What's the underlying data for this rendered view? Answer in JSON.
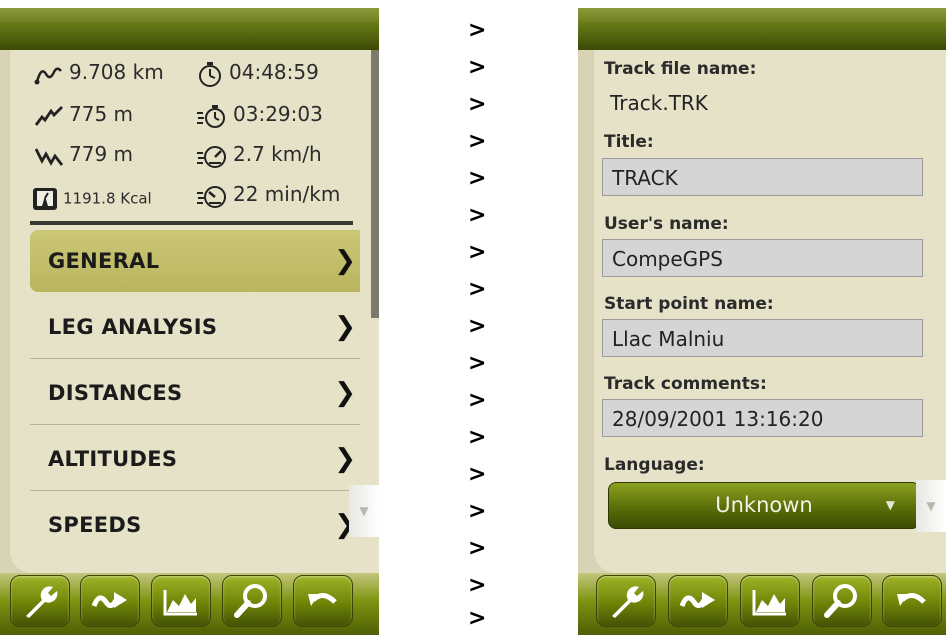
{
  "arrows": [
    ">",
    ">",
    ">",
    ">",
    ">",
    ">",
    ">",
    ">",
    ">",
    ">",
    ">",
    ">",
    ">",
    ">",
    ">",
    ">",
    ">"
  ],
  "left_screen": {
    "stats": [
      {
        "icon": "distance-icon",
        "value": "9.708 km"
      },
      {
        "icon": "stopwatch-icon",
        "value": "04:48:59"
      },
      {
        "icon": "ascent-icon",
        "value": "775 m"
      },
      {
        "icon": "moving-time-icon",
        "value": "03:29:03"
      },
      {
        "icon": "descent-icon",
        "value": "779 m"
      },
      {
        "icon": "speed-gauge-icon",
        "value": "2.7 km/h"
      },
      {
        "icon": "scale-icon",
        "value": "1191.8 Kcal"
      },
      {
        "icon": "pace-gauge-icon",
        "value": "22 min/km"
      }
    ],
    "menu": [
      {
        "label": "GENERAL",
        "chevron": "❯",
        "selected": true
      },
      {
        "label": "LEG ANALYSIS",
        "chevron": "❯",
        "selected": false
      },
      {
        "label": "DISTANCES",
        "chevron": "❯",
        "selected": false
      },
      {
        "label": "ALTITUDES",
        "chevron": "❯",
        "selected": false
      },
      {
        "label": "SPEEDS",
        "chevron": "❯",
        "selected": false
      }
    ],
    "scroll_down_glyph": "▼"
  },
  "right_screen": {
    "fields": {
      "track_file_name": {
        "label": "Track file name:",
        "value": "Track.TRK"
      },
      "title": {
        "label": "Title:",
        "value": "TRACK"
      },
      "users_name": {
        "label": "User's name:",
        "value": "CompeGPS"
      },
      "start_point_name": {
        "label": "Start point name:",
        "value": "Llac Malniu"
      },
      "track_comments": {
        "label": "Track comments:",
        "value": "28/09/2001 13:16:20"
      },
      "language": {
        "label": "Language:",
        "value": "Unknown",
        "dropdown_glyph": "▼"
      }
    },
    "scroll_down_glyph": "▼"
  },
  "toolbar": [
    "wrench-icon",
    "track-route-icon",
    "altitude-profile-icon",
    "magnifier-icon",
    "back-icon"
  ],
  "colors": {
    "accent_olive": "#6e8407",
    "menu_selected": "#c4c06c",
    "panel": "#e6e2c8"
  }
}
